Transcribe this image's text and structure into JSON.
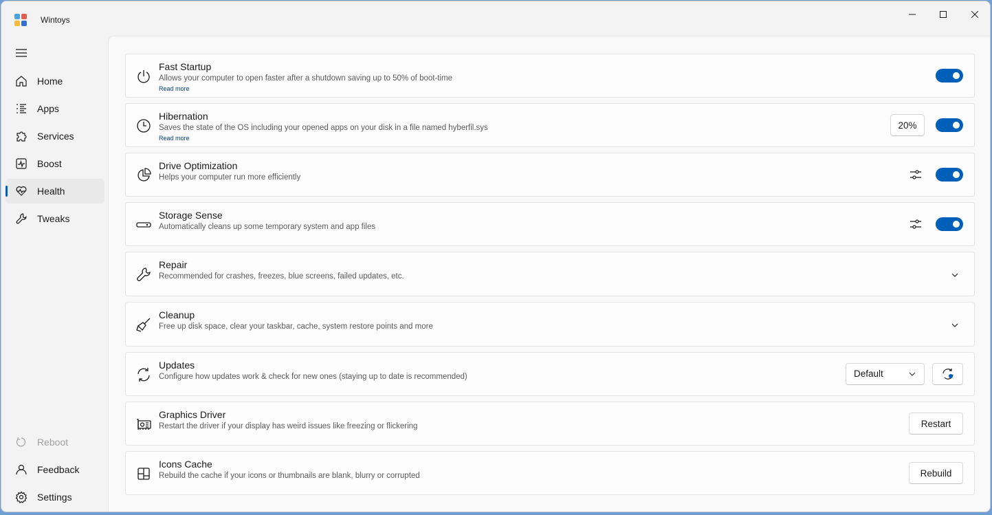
{
  "app": {
    "title": "Wintoys"
  },
  "sidebar": {
    "items": [
      {
        "label": "Home",
        "icon": "home-icon"
      },
      {
        "label": "Apps",
        "icon": "apps-list-icon"
      },
      {
        "label": "Services",
        "icon": "puzzle-icon"
      },
      {
        "label": "Boost",
        "icon": "pulse-icon"
      },
      {
        "label": "Health",
        "icon": "heart-pulse-icon",
        "active": true
      },
      {
        "label": "Tweaks",
        "icon": "wrench-icon"
      }
    ],
    "footer": [
      {
        "label": "Reboot",
        "icon": "reboot-icon",
        "disabled": true
      },
      {
        "label": "Feedback",
        "icon": "feedback-icon"
      },
      {
        "label": "Settings",
        "icon": "gear-icon"
      }
    ]
  },
  "cards": [
    {
      "title": "Fast Startup",
      "desc": "Allows your computer to open faster after a shutdown saving up to 50% of boot-time",
      "link": "Read more",
      "icon": "power-icon",
      "toggle": "on"
    },
    {
      "title": "Hibernation",
      "desc": "Saves the state of the OS including your opened apps on your disk in a file named hyberfil.sys",
      "link": "Read more",
      "icon": "clock-icon",
      "value": "20%",
      "toggle": "on"
    },
    {
      "title": "Drive Optimization",
      "desc": "Helps your computer run more efficiently",
      "icon": "pie-chart-icon",
      "toggle": "on"
    },
    {
      "title": "Storage Sense",
      "desc": "Automatically cleans up some temporary system and app files",
      "icon": "drive-icon",
      "toggle": "on"
    },
    {
      "title": "Repair",
      "desc": "Recommended for crashes, freezes, blue screens, failed updates, etc.",
      "icon": "wrench-icon"
    },
    {
      "title": "Cleanup",
      "desc": "Free up disk space, clear your taskbar, cache, system restore points and more",
      "icon": "broom-icon"
    },
    {
      "title": "Updates",
      "desc": "Configure how updates work & check for new ones (staying up to date is recommended)",
      "icon": "sync-icon",
      "dropdown": "Default"
    },
    {
      "title": "Graphics Driver",
      "desc": "Restart the driver if your display has weird issues like freezing or flickering",
      "icon": "gpu-icon",
      "button": "Restart"
    },
    {
      "title": "Icons Cache",
      "desc": "Rebuild the cache if your icons or thumbnails are blank, blurry or corrupted",
      "icon": "grid-icon",
      "button": "Rebuild"
    }
  ],
  "colors": {
    "accent": "#005fb8",
    "link": "#003e92",
    "background": "#f9f9f9"
  }
}
